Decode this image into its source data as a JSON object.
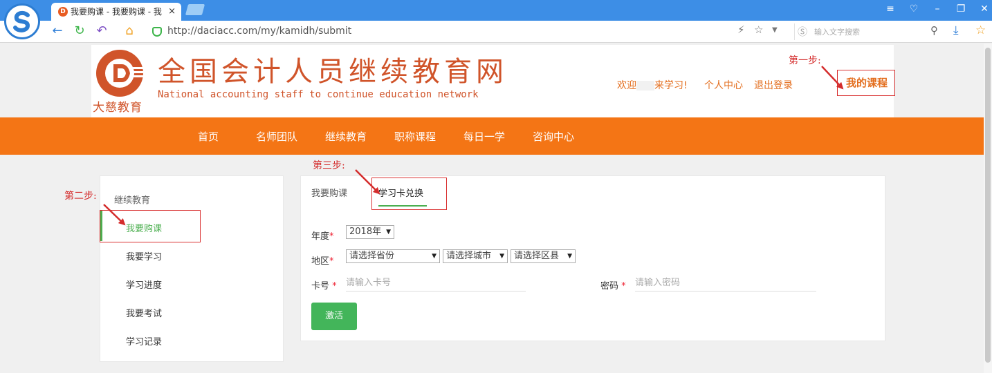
{
  "browser": {
    "tab_title": "我要购课 - 我要购课 - 我",
    "tab_close": "×",
    "url": "http://daciacc.com/my/kamidh/submit",
    "search_placeholder": "输入文字搜索"
  },
  "header": {
    "logo_sub": "大慈教育",
    "site_title": "全国会计人员继续教育网",
    "site_subtitle": "National accounting staff to continue education network",
    "welcome_prefix": "欢迎",
    "welcome_suffix": "来学习!",
    "personal_center": "个人中心",
    "logout": "退出登录",
    "my_course": "我的课程"
  },
  "nav": {
    "items": [
      "首页",
      "名师团队",
      "继续教育",
      "职称课程",
      "每日一学",
      "咨询中心"
    ]
  },
  "sidebar": {
    "title": "继续教育",
    "items": [
      "我要购课",
      "我要学习",
      "学习进度",
      "我要考试",
      "学习记录"
    ],
    "active_index": 0
  },
  "panel": {
    "tabs": [
      "我要购课",
      "学习卡兑换"
    ],
    "active_tab": 1,
    "year_label": "年度",
    "year_value": "2018年",
    "region_label": "地区",
    "province": "请选择省份",
    "city": "请选择城市",
    "district": "请选择区县",
    "card_label": "卡号",
    "card_placeholder": "请输入卡号",
    "password_label": "密码",
    "password_placeholder": "请输入密码",
    "required_mark": "*",
    "activate_button": "激活"
  },
  "annotations": {
    "step1": "第一步:",
    "step2": "第二步:",
    "step3": "第三步:",
    "color": "#d42c2c"
  },
  "colors": {
    "brand": "#d0542a",
    "nav_orange": "#f47515",
    "accent_green": "#43b55a",
    "browser_blue": "#3d8ee6"
  },
  "icons": [
    "browser-logo-icon",
    "favicon-icon",
    "back-icon",
    "refresh-icon",
    "undo-icon",
    "home-icon",
    "shield-icon",
    "lightning-icon",
    "star-icon",
    "search-icon",
    "download-icon",
    "favorites-icon"
  ]
}
